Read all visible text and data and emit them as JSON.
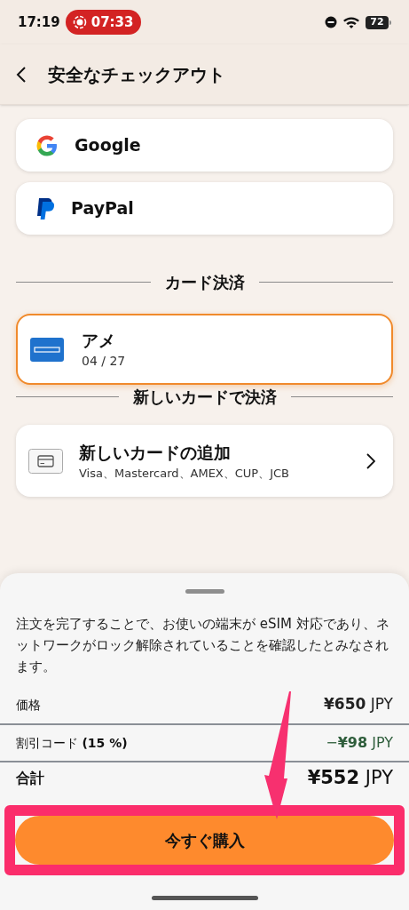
{
  "status_bar": {
    "time": "17:19",
    "recording": "07:33",
    "battery": "72"
  },
  "header": {
    "title": "安全なチェックアウト"
  },
  "wallets": [
    {
      "kind": "google",
      "label": "Google"
    },
    {
      "kind": "paypal",
      "label": "PayPal"
    }
  ],
  "saved_cards_heading": "カード決済",
  "saved_cards": [
    {
      "kind": "amex",
      "name": "アメ",
      "expiry": "04 / 27",
      "selected": true
    }
  ],
  "new_card_heading": "新しいカードで決済",
  "add_card": {
    "title": "新しいカードの追加",
    "brands": "Visa、Mastercard、AMEX、CUP、JCB"
  },
  "summary": {
    "notice": "注文を完了することで、お使いの端末が eSIM 対応であり、ネットワークがロック解除されていることを確認したとみなされます。",
    "rows": [
      {
        "kind": "price",
        "label": "価格",
        "value": "**¥650** JPY"
      },
      {
        "kind": "discount",
        "label": "割引コード **(15 %)**",
        "value": "−**¥98** JPY"
      },
      {
        "kind": "total",
        "label": "合計",
        "value": "**¥552** JPY"
      }
    ]
  },
  "buy_button": "今すぐ購入"
}
